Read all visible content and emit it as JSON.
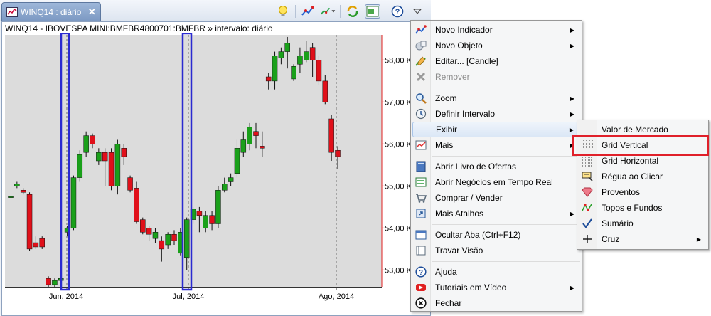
{
  "tab": {
    "title": "WINQ14 : diário",
    "close_label": "✕"
  },
  "toolbar": {
    "icons": [
      "bulb-icon",
      "indicator-icon",
      "indicator-dropdown-icon",
      "refresh-icon",
      "panel-icon",
      "help-icon",
      "view-menu-icon"
    ]
  },
  "chart": {
    "title": "WINQ14 - IBOVESPA MINI:BMFBR4800701:BMFBR » intervalo: diário",
    "y_ticks": [
      "58,00 K",
      "57,00 K",
      "56,00 K",
      "55,00 K",
      "54,00 K",
      "53,00 K"
    ],
    "x_ticks": [
      "Jun, 2014",
      "Jul, 2014",
      "Ago, 2014"
    ]
  },
  "chart_data": {
    "type": "candlestick",
    "title": "WINQ14 - IBOVESPA MINI:BMFBR4800701:BMFBR » intervalo: diário",
    "y_axis": {
      "ticks": [
        58000,
        57000,
        56000,
        55000,
        54000,
        53000
      ],
      "range": [
        52600,
        58600
      ]
    },
    "x_axis": {
      "labels": [
        "Jun, 2014",
        "Jul, 2014",
        "Ago, 2014"
      ]
    },
    "grid_vertical": true,
    "grid_horizontal": true,
    "colors": {
      "up": "#1aa01a",
      "down": "#e0101a"
    },
    "candles": [
      {
        "o": 54750,
        "c": 54750,
        "h": 54750,
        "l": 54750
      },
      {
        "o": 55000,
        "c": 55050,
        "h": 55100,
        "l": 54950
      },
      {
        "o": 54900,
        "c": 54850,
        "h": 54950,
        "l": 54800
      },
      {
        "o": 54800,
        "c": 53500,
        "h": 54850,
        "l": 53450
      },
      {
        "o": 53650,
        "c": 53550,
        "h": 53800,
        "l": 53500
      },
      {
        "o": 53750,
        "c": 53550,
        "h": 53800,
        "l": 53500
      },
      {
        "o": 52800,
        "c": 52650,
        "h": 52850,
        "l": 52600
      },
      {
        "o": 52650,
        "c": 52750,
        "h": 52800,
        "l": 52600
      },
      {
        "o": 52750,
        "c": 52800,
        "h": 52900,
        "l": 52700
      },
      {
        "o": 53900,
        "c": 54000,
        "h": 54050,
        "l": 53800
      },
      {
        "o": 54000,
        "c": 55200,
        "h": 55250,
        "l": 53950
      },
      {
        "o": 55200,
        "c": 55750,
        "h": 55850,
        "l": 55100
      },
      {
        "o": 55800,
        "c": 56200,
        "h": 56300,
        "l": 55700
      },
      {
        "o": 56200,
        "c": 56000,
        "h": 56250,
        "l": 55900
      },
      {
        "o": 55600,
        "c": 55800,
        "h": 55900,
        "l": 55500
      },
      {
        "o": 55800,
        "c": 55600,
        "h": 55900,
        "l": 55000
      },
      {
        "o": 55800,
        "c": 55000,
        "h": 55900,
        "l": 54900
      },
      {
        "o": 55000,
        "c": 56000,
        "h": 56100,
        "l": 54800
      },
      {
        "o": 55900,
        "c": 55700,
        "h": 56000,
        "l": 55500
      },
      {
        "o": 55200,
        "c": 54900,
        "h": 55250,
        "l": 54850
      },
      {
        "o": 54950,
        "c": 54150,
        "h": 55100,
        "l": 54100
      },
      {
        "o": 54200,
        "c": 53900,
        "h": 54250,
        "l": 53850
      },
      {
        "o": 54000,
        "c": 53850,
        "h": 54050,
        "l": 53700
      },
      {
        "o": 53750,
        "c": 53900,
        "h": 54000,
        "l": 53650
      },
      {
        "o": 53700,
        "c": 53500,
        "h": 53800,
        "l": 53200
      },
      {
        "o": 53600,
        "c": 53850,
        "h": 53900,
        "l": 53500
      },
      {
        "o": 53850,
        "c": 53700,
        "h": 53950,
        "l": 53600
      },
      {
        "o": 53400,
        "c": 53900,
        "h": 54000,
        "l": 53350
      },
      {
        "o": 53300,
        "c": 54200,
        "h": 54250,
        "l": 53000
      },
      {
        "o": 54200,
        "c": 54450,
        "h": 54500,
        "l": 54100
      },
      {
        "o": 54400,
        "c": 54300,
        "h": 54500,
        "l": 53900
      },
      {
        "o": 54000,
        "c": 54300,
        "h": 54400,
        "l": 53900
      },
      {
        "o": 54300,
        "c": 54100,
        "h": 54400,
        "l": 53950
      },
      {
        "o": 54100,
        "c": 54900,
        "h": 55000,
        "l": 54000
      },
      {
        "o": 54900,
        "c": 55050,
        "h": 55200,
        "l": 54850
      },
      {
        "o": 55100,
        "c": 55200,
        "h": 55300,
        "l": 55000
      },
      {
        "o": 55300,
        "c": 55900,
        "h": 56100,
        "l": 55200
      },
      {
        "o": 55800,
        "c": 56100,
        "h": 56300,
        "l": 55700
      },
      {
        "o": 56000,
        "c": 56400,
        "h": 56500,
        "l": 55850
      },
      {
        "o": 56300,
        "c": 56200,
        "h": 56500,
        "l": 55900
      },
      {
        "o": 55950,
        "c": 55900,
        "h": 56300,
        "l": 55700
      },
      {
        "o": 57600,
        "c": 57500,
        "h": 57700,
        "l": 57300
      },
      {
        "o": 57500,
        "c": 58100,
        "h": 58200,
        "l": 57300
      },
      {
        "o": 58050,
        "c": 58200,
        "h": 58300,
        "l": 57900
      },
      {
        "o": 58200,
        "c": 58400,
        "h": 58550,
        "l": 57800
      },
      {
        "o": 57550,
        "c": 57850,
        "h": 57900,
        "l": 57500
      },
      {
        "o": 57900,
        "c": 58100,
        "h": 58300,
        "l": 57700
      },
      {
        "o": 58000,
        "c": 58200,
        "h": 58450,
        "l": 57950
      },
      {
        "o": 58300,
        "c": 58000,
        "h": 58400,
        "l": 57600
      },
      {
        "o": 58000,
        "c": 57500,
        "h": 58100,
        "l": 57400
      },
      {
        "o": 57500,
        "c": 57000,
        "h": 57650,
        "l": 56950
      },
      {
        "o": 56600,
        "c": 55800,
        "h": 56700,
        "l": 55600
      },
      {
        "o": 55850,
        "c": 55700,
        "h": 55950,
        "l": 55400
      }
    ]
  },
  "main_menu": {
    "items": [
      {
        "label": "Novo Indicador",
        "icon": "new-indicator-icon",
        "submenu": true
      },
      {
        "label": "Novo Objeto",
        "icon": "new-object-icon",
        "submenu": true
      },
      {
        "label": "Editar... [Candle]",
        "icon": "edit-icon",
        "submenu": false
      },
      {
        "label": "Remover",
        "icon": "remove-icon",
        "submenu": false,
        "disabled": true
      },
      {
        "label": "Zoom",
        "icon": "zoom-icon",
        "submenu": true
      },
      {
        "label": "Definir Intervalo",
        "icon": "interval-icon",
        "submenu": true
      },
      {
        "label": "Exibir",
        "icon": "",
        "submenu": true,
        "hover": true
      },
      {
        "label": "Mais",
        "icon": "more-icon",
        "submenu": true
      },
      {
        "label": "Abrir Livro de Ofertas",
        "icon": "book-icon",
        "submenu": false
      },
      {
        "label": "Abrir Negócios em Tempo Real",
        "icon": "realtime-icon",
        "submenu": false
      },
      {
        "label": "Comprar / Vender",
        "icon": "cart-icon",
        "submenu": false
      },
      {
        "label": "Mais Atalhos",
        "icon": "shortcut-icon",
        "submenu": true
      },
      {
        "label": "Ocultar Aba (Ctrl+F12)",
        "icon": "hide-tab-icon",
        "submenu": false
      },
      {
        "label": "Travar Visão",
        "icon": "lock-view-icon",
        "submenu": false
      },
      {
        "label": "Ajuda",
        "icon": "help-icon",
        "submenu": false
      },
      {
        "label": "Tutoriais em Vídeo",
        "icon": "video-icon",
        "submenu": true
      },
      {
        "label": "Fechar",
        "icon": "close-circle-icon",
        "submenu": false
      }
    ]
  },
  "submenu": {
    "items": [
      {
        "label": "Valor de Mercado",
        "icon": "",
        "submenu": false
      },
      {
        "label": "Grid Vertical",
        "icon": "grid-vertical-icon",
        "submenu": false,
        "highlighted": true
      },
      {
        "label": "Grid Horizontal",
        "icon": "grid-horizontal-icon",
        "submenu": false
      },
      {
        "label": "Régua ao Clicar",
        "icon": "ruler-icon",
        "submenu": false
      },
      {
        "label": "Proventos",
        "icon": "dividend-icon",
        "submenu": false
      },
      {
        "label": "Topos e Fundos",
        "icon": "tops-bottoms-icon",
        "submenu": false
      },
      {
        "label": "Sumário",
        "icon": "check-icon",
        "submenu": false
      },
      {
        "label": "Cruz",
        "icon": "crosshair-icon",
        "submenu": true
      }
    ]
  }
}
